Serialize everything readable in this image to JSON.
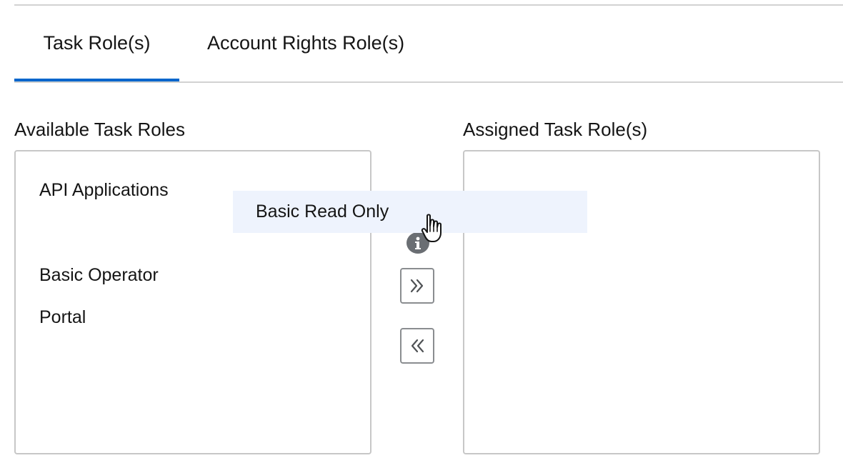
{
  "tabs": [
    {
      "label": "Task Role(s)",
      "active": true
    },
    {
      "label": "Account Rights Role(s)",
      "active": false
    }
  ],
  "available": {
    "label": "Available Task Roles",
    "items": [
      "API Applications",
      "Basic Operator",
      "Portal"
    ]
  },
  "assigned": {
    "label": "Assigned Task Role(s)",
    "items": []
  },
  "dragged_item": "Basic Read Only",
  "controls": {
    "add_icon": "double-chevron-right-icon",
    "remove_icon": "double-chevron-left-icon"
  },
  "colors": {
    "accent": "#0066cc",
    "drag_highlight": "#eef3fd",
    "border": "#c7c7c7"
  }
}
